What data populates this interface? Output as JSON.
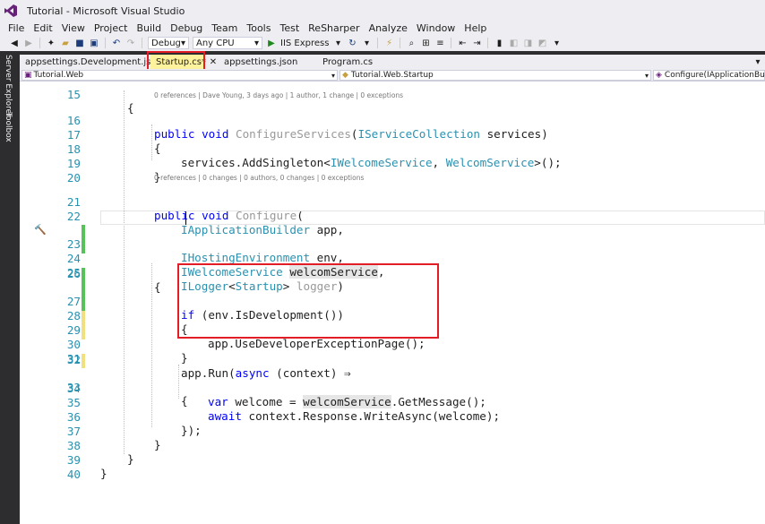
{
  "window": {
    "title": "Tutorial - Microsoft Visual Studio"
  },
  "menu": [
    "File",
    "Edit",
    "View",
    "Project",
    "Build",
    "Debug",
    "Team",
    "Tools",
    "Test",
    "ReSharper",
    "Analyze",
    "Window",
    "Help"
  ],
  "toolbar": {
    "configuration": "Debug",
    "platform": "Any CPU",
    "run_label": "IIS Express"
  },
  "siderail": {
    "server_explorer": "Server Explorer",
    "toolbox": "Toolbox"
  },
  "tabs": [
    {
      "label": "appsettings.Development.json",
      "active": false
    },
    {
      "label": "Startup.cs*",
      "active": true
    },
    {
      "label": "appsettings.json",
      "active": false
    },
    {
      "label": "Program.cs",
      "active": false
    }
  ],
  "navbar": {
    "project": "Tutorial.Web",
    "type": "Tutorial.Web.Startup",
    "member": "Configure(IApplicationBuilde"
  },
  "lens": {
    "configure_services": "0 references | Dave Young, 3 days ago | 1 author, 1 change | 0 exceptions",
    "configure": "0 references | 0 changes | 0 authors, 0 changes | 0 exceptions"
  },
  "code": {
    "l15": "{",
    "l16a": "public void ",
    "l16b": "ConfigureServices",
    "l16c": "(",
    "l16d": "IServiceCollection",
    "l16e": " services)",
    "l17": "{",
    "l18a": "services.AddSingleton<",
    "l18b": "IWelcomeService",
    "l18c": ", ",
    "l18d": "WelcomService",
    "l18e": ">();",
    "l19": "}",
    "l21a": "public void ",
    "l21b": "Configure",
    "l21c": "(",
    "l22a": "IApplicationBuilder",
    "l22b": " app,",
    "l23a": "IHostingEnvironment",
    "l23b": " env,",
    "l24a": "IWelcomeService",
    "l24b": " ",
    "l24c": "welcomService",
    "l24d": ",",
    "l25a": "ILogger",
    "l25b": "<",
    "l25c": "Startup",
    "l25d": "> ",
    "l25e": "logger",
    "l25f": ")",
    "l26": "{",
    "l27a": "if",
    "l27b": " (env.IsDevelopment())",
    "l28": "{",
    "l29": "app.UseDeveloperExceptionPage();",
    "l30": "}",
    "l32a": "app.Run(",
    "l32b": "async",
    "l32c": " (context) ",
    "l32d": "⇒",
    "l33": "{",
    "l34a": "var",
    "l34b": " welcome = ",
    "l34c": "welcomService",
    "l34d": ".GetMessage();",
    "l35a": "await",
    "l35b": " context.Response.WriteAsync(welcome);",
    "l36": "});",
    "l37": "}",
    "l38": "}",
    "l39": "}"
  },
  "line_numbers": [
    "15",
    "16",
    "17",
    "18",
    "19",
    "20",
    "21",
    "22",
    "23",
    "24",
    "25",
    "26",
    "27",
    "28",
    "29",
    "30",
    "31",
    "32",
    "33",
    "34",
    "35",
    "36",
    "37",
    "38",
    "39",
    "40"
  ],
  "colors": {
    "keyword": "#0000ff",
    "type": "#2b91af",
    "line_number": "#2b91af",
    "highlight_box": "#e31d25",
    "change_saved": "#57c25a",
    "change_unsaved": "#f0e080"
  }
}
